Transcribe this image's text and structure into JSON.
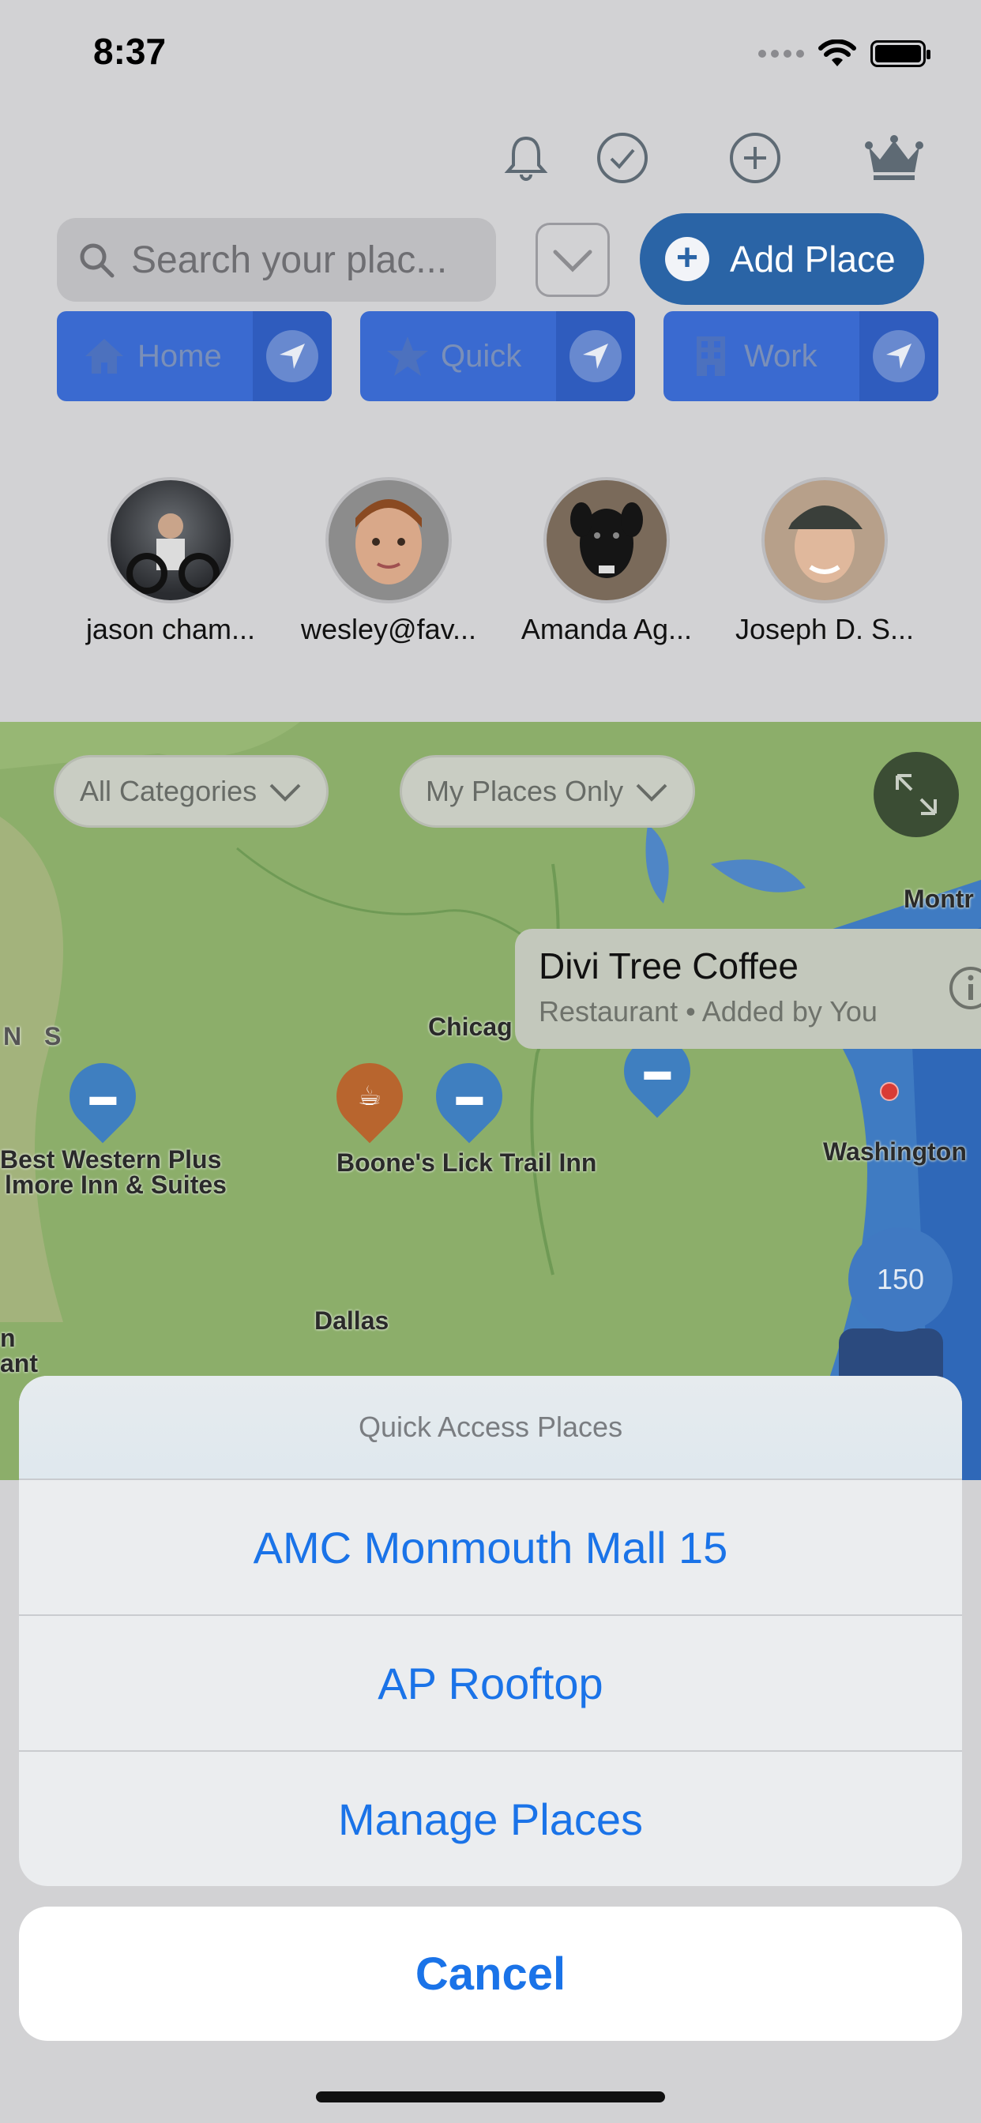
{
  "status_bar": {
    "time": "8:37"
  },
  "header": {
    "search": {
      "placeholder": "Search your plac..."
    },
    "add_place_label": "Add Place"
  },
  "quick_tiles": [
    {
      "label": "Home",
      "icon": "home-icon"
    },
    {
      "label": "Quick",
      "icon": "star-icon"
    },
    {
      "label": "Work",
      "icon": "building-icon"
    }
  ],
  "friends": [
    {
      "name": "jason cham..."
    },
    {
      "name": "wesley@fav..."
    },
    {
      "name": "Amanda Ag..."
    },
    {
      "name": "Joseph D. S..."
    }
  ],
  "map": {
    "filters": {
      "category": "All Categories",
      "scope": "My Places Only"
    },
    "callout": {
      "title": "Divi Tree Coffee",
      "subtitle": "Restaurant • Added by You"
    },
    "labels": {
      "montreal": "Montr",
      "chicago": "Chicag",
      "washington": "Washington",
      "dallas": "Dallas",
      "best_western": "Best Western Plus",
      "filmore_inn": "lmore Inn & Suites",
      "boones_lick": "Boone's Lick Trail Inn",
      "left_edge_1": "n",
      "left_edge_2": "ant",
      "region_letters": "N S"
    },
    "place_count": "150"
  },
  "action_sheet": {
    "title": "Quick Access Places",
    "items": [
      "AMC Monmouth Mall 15",
      "AP Rooftop",
      "Manage Places"
    ],
    "cancel_label": "Cancel"
  },
  "colors": {
    "accent": "#1a73e8",
    "add_place_bg": "#2a64a6",
    "tile_bg": "#3a6ad0",
    "map_land": "#8cae6a",
    "map_water": "#4f86c6",
    "coffee_pin": "#b8652e",
    "hotel_pin": "#3f7fc0"
  }
}
